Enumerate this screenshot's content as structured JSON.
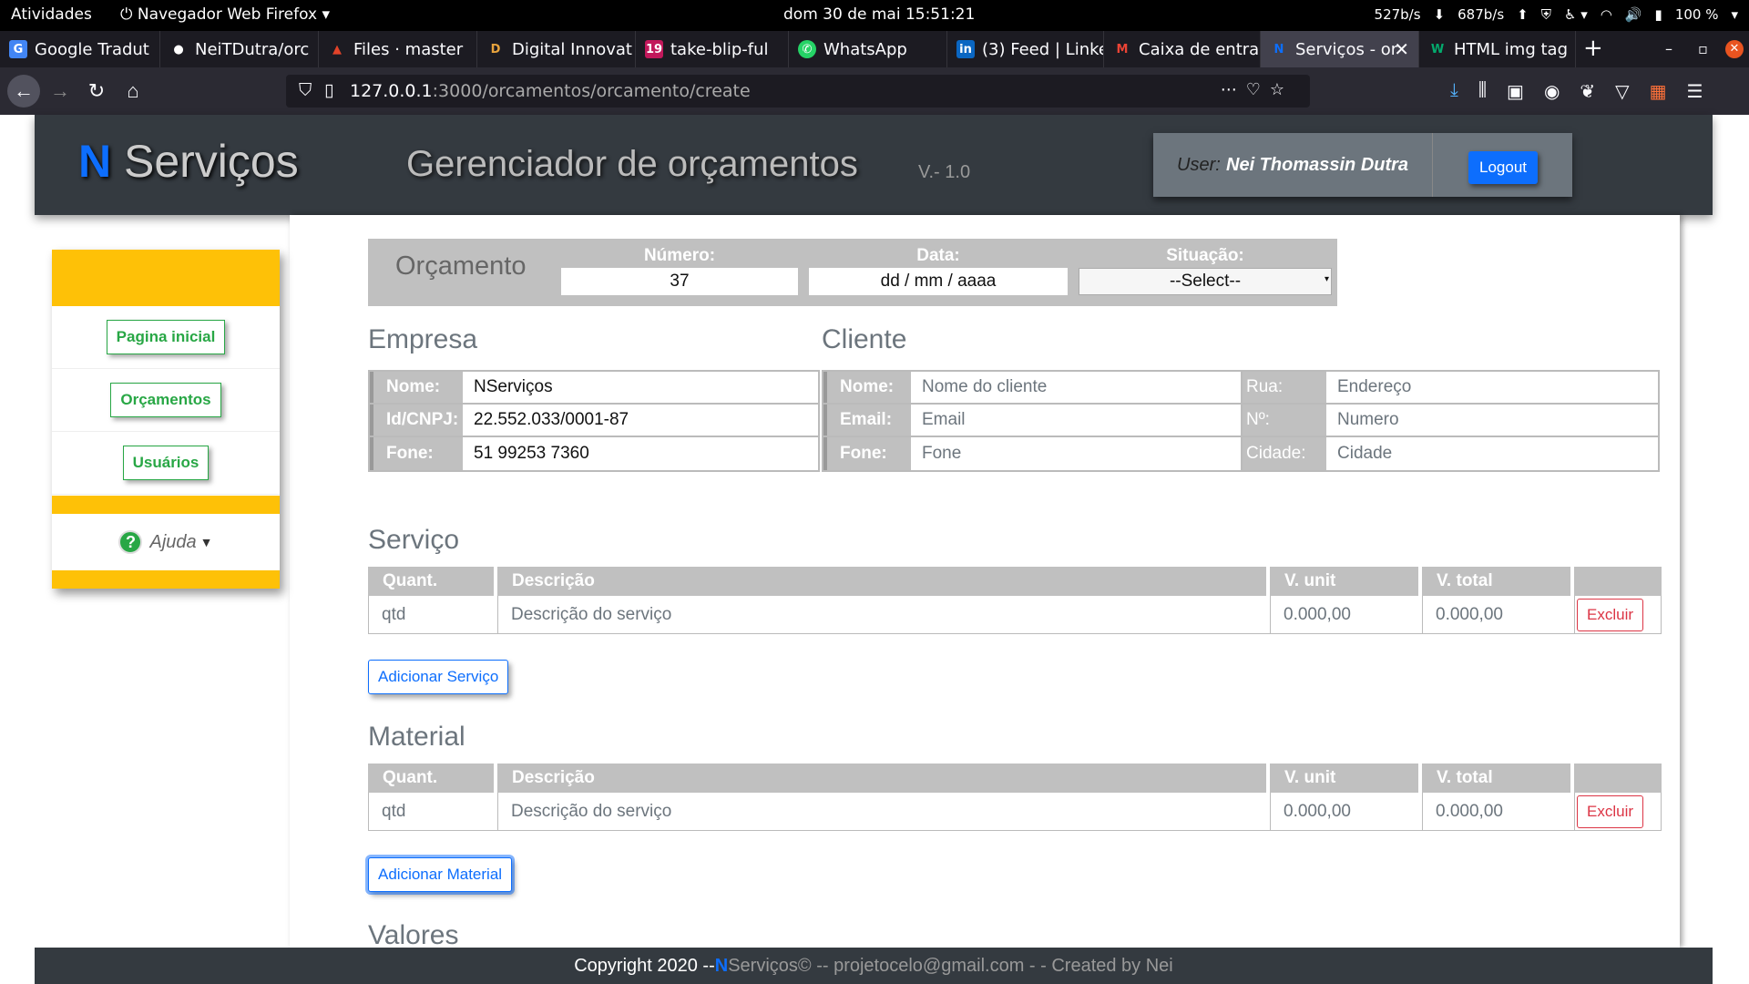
{
  "system": {
    "activities": "Atividades",
    "app_menu": "Navegador Web Firefox",
    "clock": "dom 30 de mai  15:51:21",
    "net_down": "527b/s",
    "net_up": "687b/s",
    "battery": "100 %"
  },
  "browser": {
    "tabs": [
      {
        "label": "Google Tradut",
        "icon": "google-translate-icon",
        "color": "#4285f4",
        "glyph": "G"
      },
      {
        "label": "NeiTDutra/orc",
        "icon": "github-icon",
        "color": "#ffffff",
        "glyph": "●"
      },
      {
        "label": "Files · master",
        "icon": "gitlab-icon",
        "color": "#e24329",
        "glyph": "▲"
      },
      {
        "label": "Digital Innovat",
        "icon": "dio-icon",
        "color": "#e8a33d",
        "glyph": "D"
      },
      {
        "label": "take-blip-ful",
        "icon": "blip-icon",
        "color": "#c2185b",
        "glyph": "19"
      },
      {
        "label": "WhatsApp",
        "icon": "whatsapp-icon",
        "color": "#25d366",
        "glyph": "✆"
      },
      {
        "label": "(3) Feed | Linke",
        "icon": "linkedin-icon",
        "color": "#0a66c2",
        "glyph": "in"
      },
      {
        "label": "Caixa de entra",
        "icon": "gmail-icon",
        "color": "#ea4335",
        "glyph": "M"
      },
      {
        "label": "Serviços - or",
        "icon": "nservicos-icon",
        "color": "#0d6efd",
        "glyph": "N"
      },
      {
        "label": "HTML img tag",
        "icon": "w3schools-icon",
        "color": "#04aa6d",
        "glyph": "W"
      }
    ],
    "url_host": "127.0.0.1",
    "url_path": ":3000/orcamentos/orcamento/create"
  },
  "header": {
    "brand_n": "N",
    "brand_rest": " Serviços",
    "subtitle": "Gerenciador de orçamentos",
    "version": "V.- 1.0",
    "user_label": "User:",
    "user_name": "Nei Thomassin Dutra",
    "logout": "Logout"
  },
  "sidebar": {
    "items": [
      {
        "label": "Pagina inicial"
      },
      {
        "label": "Orçamentos"
      },
      {
        "label": "Usuários"
      }
    ],
    "help_label": "Ajuda"
  },
  "orcamento": {
    "title": "Orçamento",
    "numero_label": "Número:",
    "numero_value": "37",
    "data_label": "Data:",
    "data_placeholder": "dd / mm / aaaa",
    "situacao_label": "Situação:",
    "situacao_value": "--Select--"
  },
  "empresa": {
    "title": "Empresa",
    "rows": [
      {
        "k": "Nome:",
        "v": "NServiços"
      },
      {
        "k": "Id/CNPJ:",
        "v": "22.552.033/0001-87"
      },
      {
        "k": "Fone:",
        "v": "51 99253 7360"
      }
    ]
  },
  "cliente": {
    "title": "Cliente",
    "rows": [
      {
        "k": "Nome:",
        "v": "Nome do cliente",
        "k2": "Rua:",
        "v2": "Endereço"
      },
      {
        "k": "Email:",
        "v": "Email",
        "k2": "Nº:",
        "v2": "Numero"
      },
      {
        "k": "Fone:",
        "v": "Fone",
        "k2": "Cidade:",
        "v2": "Cidade"
      }
    ]
  },
  "servico": {
    "title": "Serviço",
    "headers": [
      "Quant.",
      "Descrição",
      "V. unit",
      "V. total",
      ""
    ],
    "row": {
      "qtd": "qtd",
      "desc": "Descrição do serviço",
      "unit": "0.000,00",
      "total": "0.000,00",
      "action": "Excluir"
    },
    "add": "Adicionar Serviço"
  },
  "material": {
    "title": "Material",
    "headers": [
      "Quant.",
      "Descrição",
      "V. unit",
      "V. total",
      ""
    ],
    "row": {
      "qtd": "qtd",
      "desc": "Descrição do serviço",
      "unit": "0.000,00",
      "total": "0.000,00",
      "action": "Excluir"
    },
    "add": "Adicionar Material"
  },
  "valores": {
    "title": "Valores"
  },
  "footer": {
    "prefix": "Copyright 2020 -- ",
    "n": "N",
    "rest": "Serviços© -- projetocelo@gmail.com - - Created by Nei"
  }
}
